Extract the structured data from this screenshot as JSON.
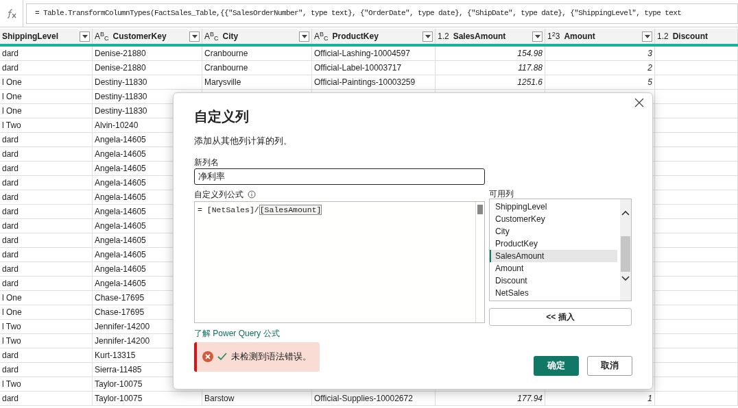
{
  "formula_bar": {
    "formula": "= Table.TransformColumnTypes(FactSales_Table,{{\"SalesOrderNumber\", type text}, {\"OrderDate\", type date}, {\"ShipDate\", type date}, {\"ShippingLevel\", type text"
  },
  "table": {
    "columns": [
      {
        "name": "ShippingLevel",
        "filter": true
      },
      {
        "name": "CustomerKey",
        "type_label": "A$^{B}$$_{C}$",
        "filter": true
      },
      {
        "name": "City",
        "type_label": "A$^{B}$$_{C}$",
        "filter": true
      },
      {
        "name": "ProductKey",
        "type_label": "A$^{B}$$_{C}$",
        "filter": true
      },
      {
        "name": "SalesAmount",
        "type_label": "1.2",
        "filter": true
      },
      {
        "name": "Amount",
        "type_label": "1$^{2}$3",
        "filter": true
      },
      {
        "name": "Discount",
        "type_label": "1.2",
        "filter": false
      }
    ],
    "rows": [
      {
        "cells": [
          "dard",
          "Denise-21880",
          "Cranbourne",
          "Official-Lashing-10004597",
          "154.98",
          "3"
        ]
      },
      {
        "cells": [
          "dard",
          "Denise-21880",
          "Cranbourne",
          "Official-Label-10003717",
          "117.88",
          "2"
        ]
      },
      {
        "cells": [
          "l One",
          "Destiny-11830",
          "Marysville",
          "Official-Paintings-10003259",
          "1251.6",
          "5"
        ]
      },
      {
        "cells": [
          "l One",
          "Destiny-11830"
        ]
      },
      {
        "cells": [
          "l One",
          "Destiny-11830"
        ]
      },
      {
        "cells": [
          "l Two",
          "Alvin-10240"
        ]
      },
      {
        "cells": [
          "dard",
          "Angela-14605"
        ]
      },
      {
        "cells": [
          "dard",
          "Angela-14605"
        ]
      },
      {
        "cells": [
          "dard",
          "Angela-14605"
        ]
      },
      {
        "cells": [
          "dard",
          "Angela-14605"
        ]
      },
      {
        "cells": [
          "dard",
          "Angela-14605"
        ]
      },
      {
        "cells": [
          "dard",
          "Angela-14605"
        ]
      },
      {
        "cells": [
          "dard",
          "Angela-14605"
        ]
      },
      {
        "cells": [
          "dard",
          "Angela-14605"
        ]
      },
      {
        "cells": [
          "dard",
          "Angela-14605"
        ]
      },
      {
        "cells": [
          "dard",
          "Angela-14605"
        ]
      },
      {
        "cells": [
          "dard",
          "Angela-14605"
        ]
      },
      {
        "cells": [
          "l One",
          "Chase-17695"
        ]
      },
      {
        "cells": [
          "l One",
          "Chase-17695"
        ]
      },
      {
        "cells": [
          "l Two",
          "Jennifer-14200"
        ]
      },
      {
        "cells": [
          "l Two",
          "Jennifer-14200"
        ]
      },
      {
        "cells": [
          "dard",
          "Kurt-13315"
        ]
      },
      {
        "cells": [
          "dard",
          "Sierra-11485"
        ]
      },
      {
        "cells": [
          "l Two",
          "Taylor-10075"
        ]
      },
      {
        "cells": [
          "dard",
          "Taylor-10075",
          "Barstow",
          "Official-Supplies-10002672",
          "177.94",
          "1"
        ]
      }
    ]
  },
  "dialog": {
    "title": "自定义列",
    "description": "添加从其他列计算的列。",
    "name_label": "新列名",
    "name_value": "净利率",
    "formula_label": "自定义列公式",
    "formula_before": "= [NetSales]/",
    "formula_bracketed": "[SalesAmount]",
    "columns_label": "可用列",
    "available_columns": [
      {
        "name": "ShippingLevel",
        "selected": false
      },
      {
        "name": "CustomerKey",
        "selected": false
      },
      {
        "name": "City",
        "selected": false
      },
      {
        "name": "ProductKey",
        "selected": false
      },
      {
        "name": "SalesAmount",
        "selected": true
      },
      {
        "name": "Amount",
        "selected": false
      },
      {
        "name": "Discount",
        "selected": false
      },
      {
        "name": "NetSales",
        "selected": false
      }
    ],
    "insert_button": "<< 插入",
    "learn_link": "了解 Power Query 公式",
    "status": {
      "error": true,
      "valid": true,
      "message": "未检测到语法错误。"
    },
    "ok_button": "确定",
    "cancel_button": "取消"
  }
}
